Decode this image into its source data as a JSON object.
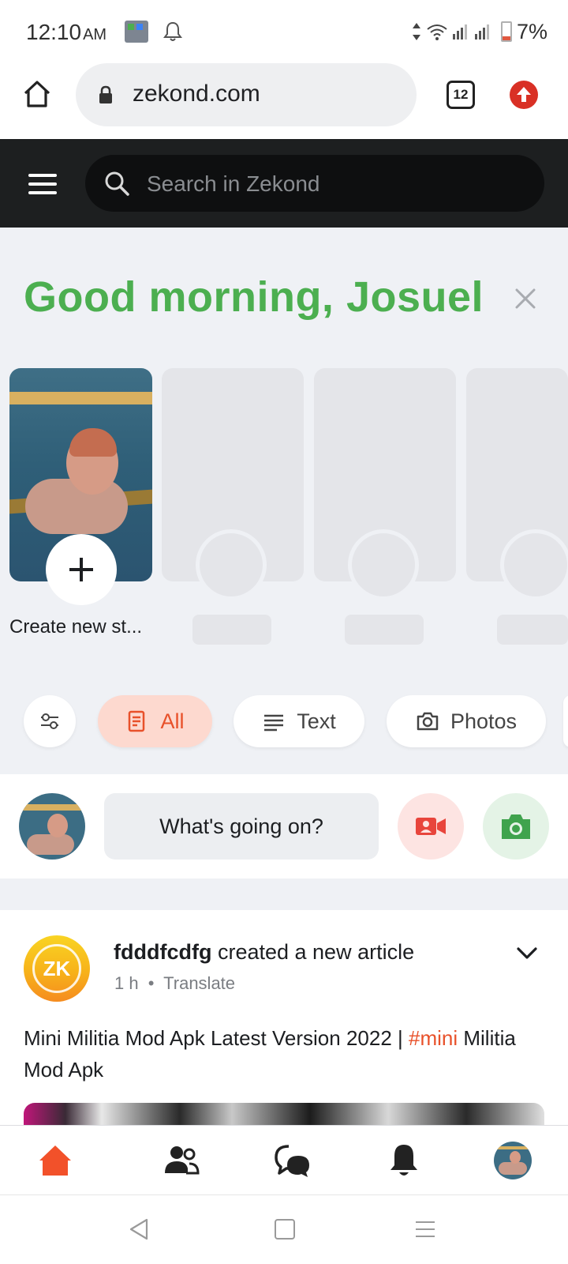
{
  "status_bar": {
    "time": "12:10",
    "ampm": "AM",
    "battery_percent": "7%"
  },
  "browser": {
    "url": "zekond.com",
    "tab_count": "12"
  },
  "app_header": {
    "search_placeholder": "Search in Zekond"
  },
  "greeting": {
    "text": "Good morning, Josuel"
  },
  "stories": {
    "create_label": "Create new st..."
  },
  "filters": {
    "items": [
      {
        "label": "All",
        "active": true
      },
      {
        "label": "Text",
        "active": false
      },
      {
        "label": "Photos",
        "active": false
      }
    ]
  },
  "composer": {
    "prompt": "What's going on?"
  },
  "post": {
    "avatar_text": "ZK",
    "author": "fdddfcdfg",
    "action": " created a new article",
    "time": "1 h",
    "separator": "•",
    "translate": "Translate",
    "text_before_tag": "Mini Militia Mod Apk Latest Version 2022 | ",
    "tag": "#mini",
    "text_after_tag": " Militia Mod Apk"
  },
  "colors": {
    "accent_green": "#4caf50",
    "accent_orange": "#e8512a",
    "header_dark": "#1d1f20"
  },
  "icons": {
    "bottom_nav": [
      "home-icon",
      "friends-icon",
      "chat-icon",
      "bell-icon",
      "profile-avatar"
    ]
  }
}
